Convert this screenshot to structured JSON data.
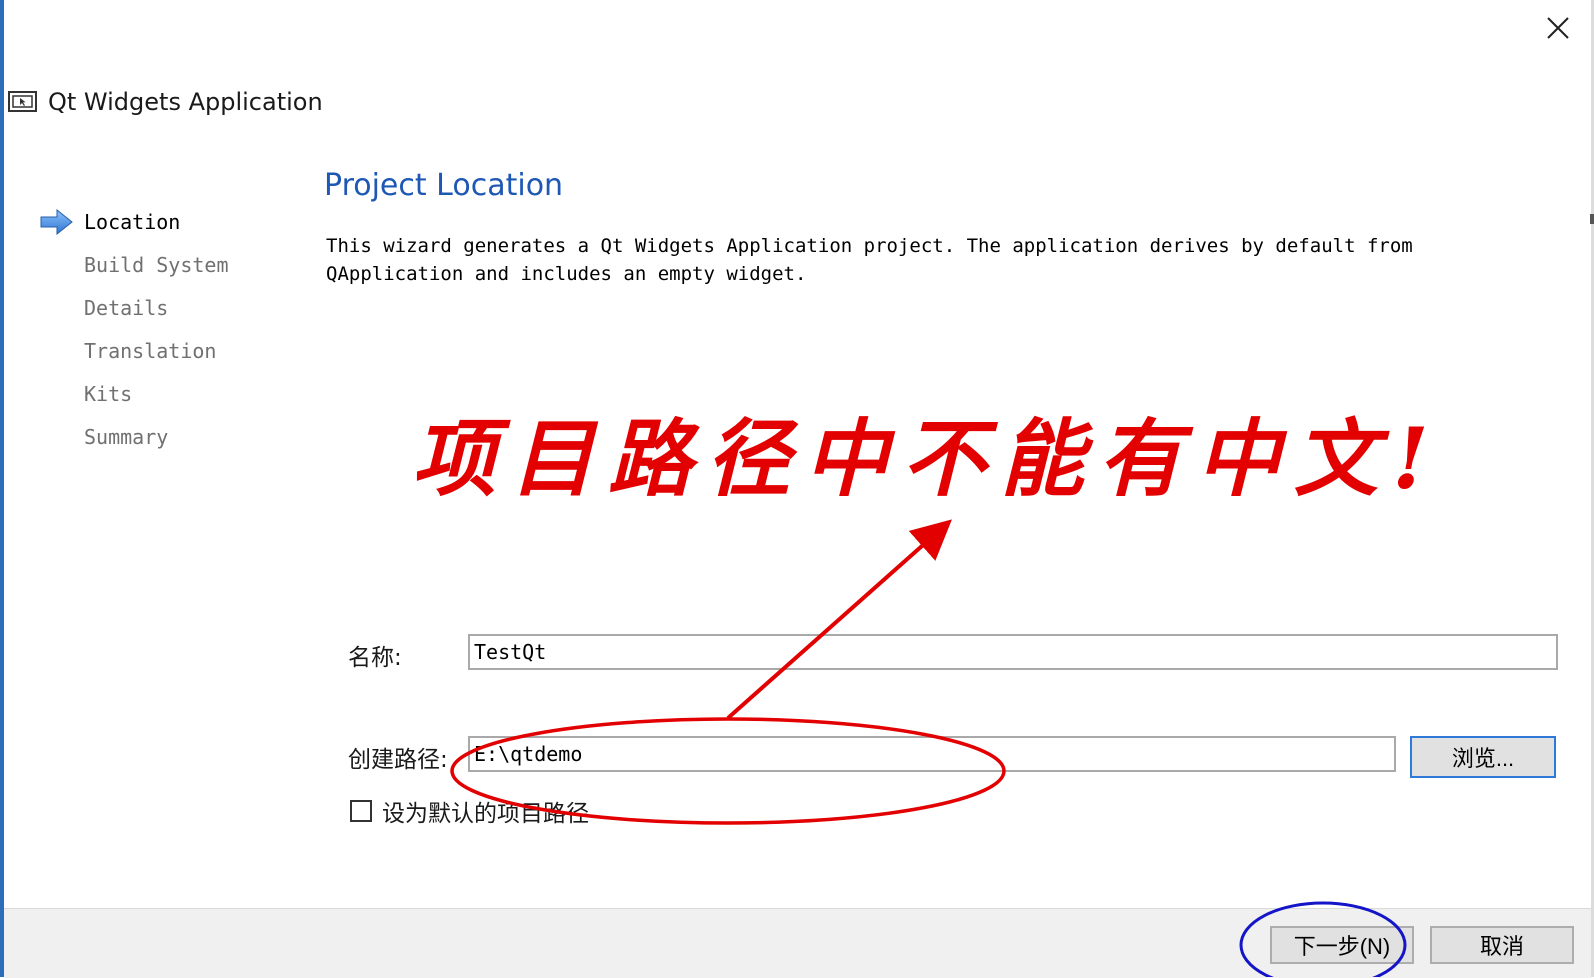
{
  "wizard": {
    "title": "Qt Widgets Application"
  },
  "steps": [
    {
      "label": "Location",
      "active": true
    },
    {
      "label": "Build System",
      "active": false
    },
    {
      "label": "Details",
      "active": false
    },
    {
      "label": "Translation",
      "active": false
    },
    {
      "label": "Kits",
      "active": false
    },
    {
      "label": "Summary",
      "active": false
    }
  ],
  "page": {
    "title": "Project Location",
    "description": "This wizard generates a Qt Widgets Application project. The application derives by default from\nQApplication and includes an empty widget."
  },
  "annotation": {
    "text": "项目路径中不能有中文!"
  },
  "form": {
    "name_label": "名称:",
    "name_value": "TestQt",
    "path_label": "创建路径:",
    "path_value": "E:\\qtdemo",
    "browse_label": "浏览...",
    "default_checkbox_label": "设为默认的项目路径",
    "default_checked": false
  },
  "footer": {
    "next_label": "下一步(N)",
    "cancel_label": "取消"
  },
  "colors": {
    "accent": "#1e58b4",
    "annotation_red": "#e30000",
    "annotation_blue": "#1414c8"
  },
  "icons": {
    "close": "close-icon",
    "app": "app-window-icon",
    "step_arrow": "arrow-right-icon"
  }
}
